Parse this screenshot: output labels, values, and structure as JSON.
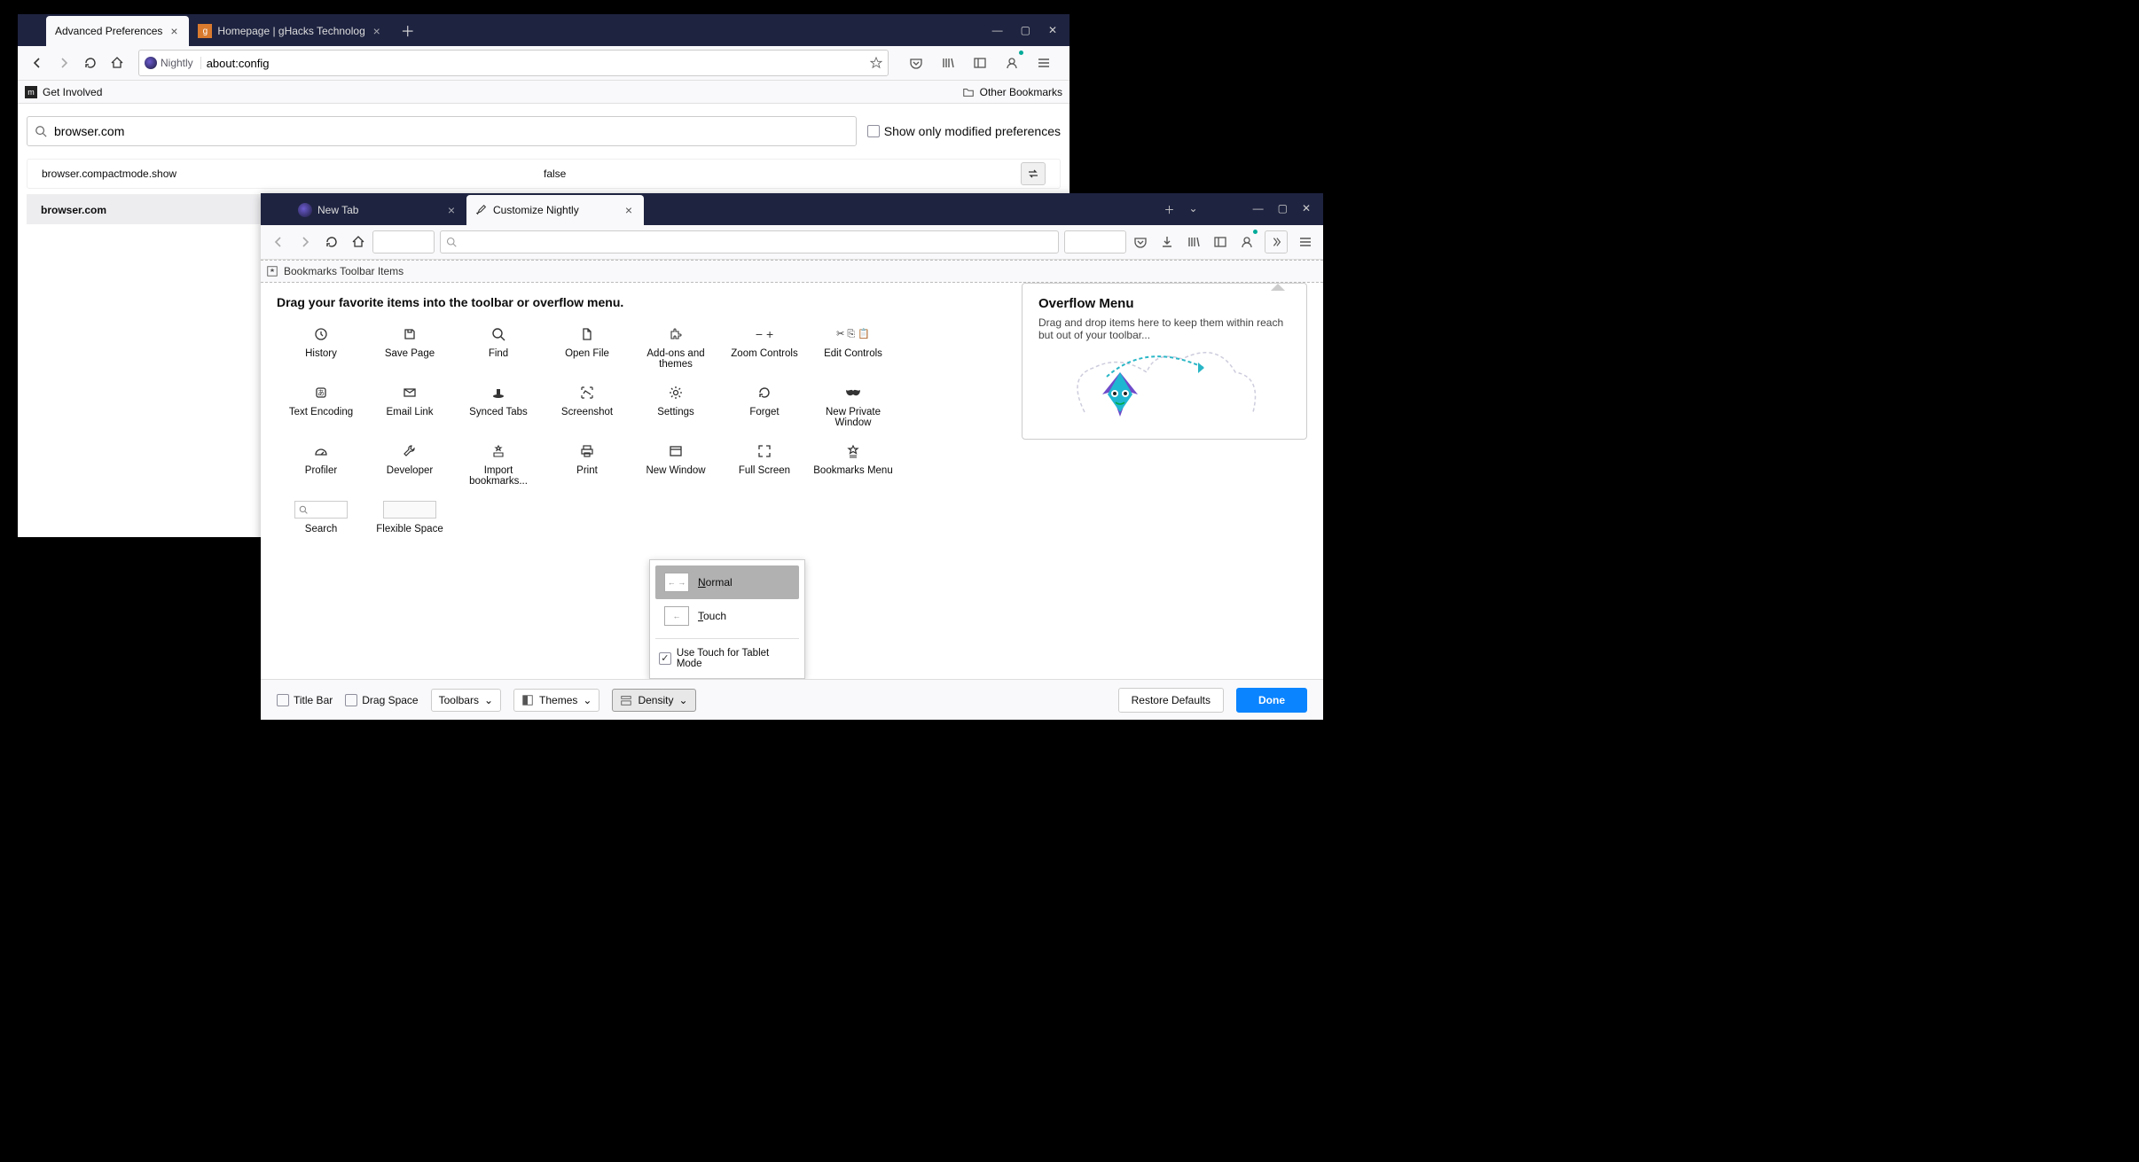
{
  "w1": {
    "tabs": [
      {
        "title": "Advanced Preferences",
        "active": true
      },
      {
        "title": "Homepage | gHacks Technolog",
        "active": false
      }
    ],
    "identity": "Nightly",
    "url": "about:config",
    "bookmarks": {
      "left": "Get Involved",
      "right": "Other Bookmarks"
    },
    "search_value": "browser.com",
    "show_modified_label": "Show only modified preferences",
    "pref": {
      "name": "browser.compactmode.show",
      "value": "false"
    },
    "footer": "browser.com"
  },
  "w2": {
    "tabs": [
      {
        "title": "New Tab",
        "active": false
      },
      {
        "title": "Customize Nightly",
        "active": true
      }
    ],
    "bmk_label": "Bookmarks Toolbar Items",
    "heading": "Drag your favorite items into the toolbar or overflow menu.",
    "items": [
      "History",
      "Save Page",
      "Find",
      "Open File",
      "Add-ons and themes",
      "Zoom Controls",
      "Edit Controls",
      "Text Encoding",
      "Email Link",
      "Synced Tabs",
      "Screenshot",
      "Settings",
      "Forget",
      "New Private Window",
      "Profiler",
      "Developer",
      "Import bookmarks...",
      "Print",
      "New Window",
      "Full Screen",
      "Bookmarks Menu",
      "Search",
      "Flexible Space"
    ],
    "overflow": {
      "title": "Overflow Menu",
      "desc": "Drag and drop items here to keep them within reach but out of your toolbar..."
    },
    "density": {
      "normal": "Normal",
      "touch": "Touch",
      "tablet": "Use Touch for Tablet Mode"
    },
    "bottom": {
      "titlebar": "Title Bar",
      "dragspace": "Drag Space",
      "toolbars": "Toolbars",
      "themes": "Themes",
      "density": "Density",
      "restore": "Restore Defaults",
      "done": "Done"
    }
  }
}
